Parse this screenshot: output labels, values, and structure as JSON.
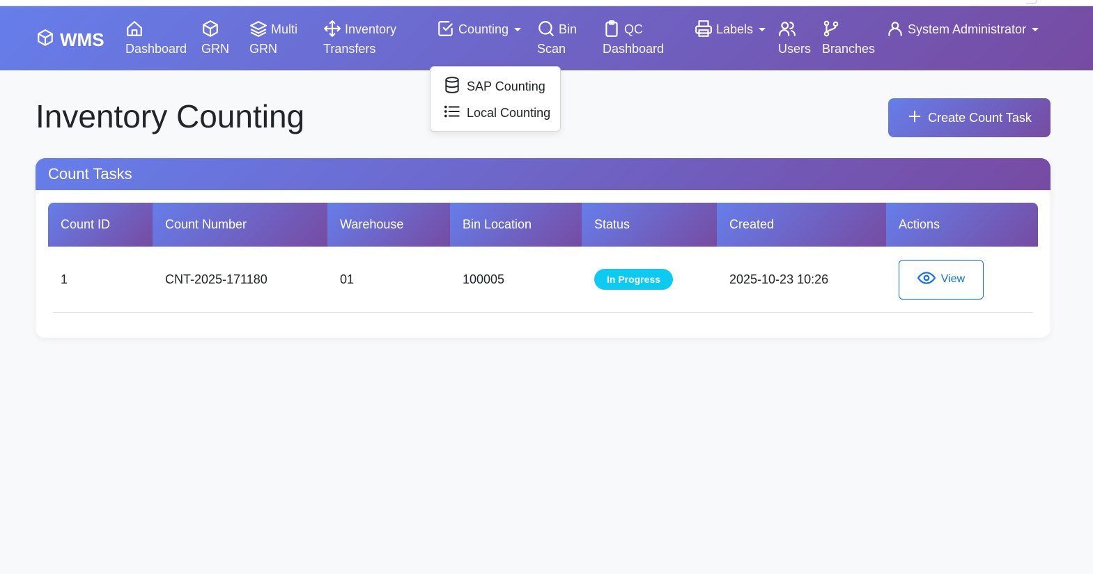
{
  "brand": {
    "name": "WMS",
    "icon": "box-icon"
  },
  "nav": {
    "dashboard": {
      "line1": "",
      "line2": "Dashboard",
      "icon": "home-icon"
    },
    "grn": {
      "line1": "",
      "line2": "GRN",
      "icon": "box-icon"
    },
    "multi_grn": {
      "line1": "Multi",
      "line2": "GRN",
      "icon": "layers-icon"
    },
    "inventory_transfers": {
      "line1": "Inventory",
      "line2": "Transfers",
      "icon": "move-arrows-icon"
    },
    "counting": {
      "line1": "Counting",
      "icon": "check-square-icon"
    },
    "bin_scan": {
      "line1": "Bin",
      "line2": "Scan",
      "icon": "search-icon"
    },
    "qc_dashboard": {
      "line1": "QC",
      "line2": "Dashboard",
      "icon": "clipboard-icon"
    },
    "labels": {
      "line1": "Labels",
      "icon": "printer-icon"
    },
    "users": {
      "line1": "",
      "line2": "Users",
      "icon": "users-icon"
    },
    "branches": {
      "line1": "",
      "line2": "Branches",
      "icon": "git-branch-icon"
    },
    "user_menu": {
      "line1": "System Administrator",
      "icon": "user-icon"
    }
  },
  "counting_dropdown": {
    "items": [
      {
        "label": "SAP Counting",
        "icon": "database-icon"
      },
      {
        "label": "Local Counting",
        "icon": "list-icon"
      }
    ]
  },
  "page": {
    "title": "Inventory Counting"
  },
  "create_button": {
    "label": "Create Count Task",
    "icon": "plus-icon"
  },
  "card": {
    "title": "Count Tasks"
  },
  "table": {
    "columns": [
      "Count ID",
      "Count Number",
      "Warehouse",
      "Bin Location",
      "Status",
      "Created",
      "Actions"
    ],
    "rows": [
      {
        "count_id": "1",
        "count_number": "CNT-2025-171180",
        "warehouse": "01",
        "bin_location": "100005",
        "status": "In Progress",
        "created": "2025-10-23 10:26",
        "action_label": "View"
      }
    ]
  },
  "colors": {
    "gradient_start": "#667eea",
    "gradient_end": "#764ba2",
    "status_info": "#0dcaf0",
    "primary": "#0d6efd"
  }
}
